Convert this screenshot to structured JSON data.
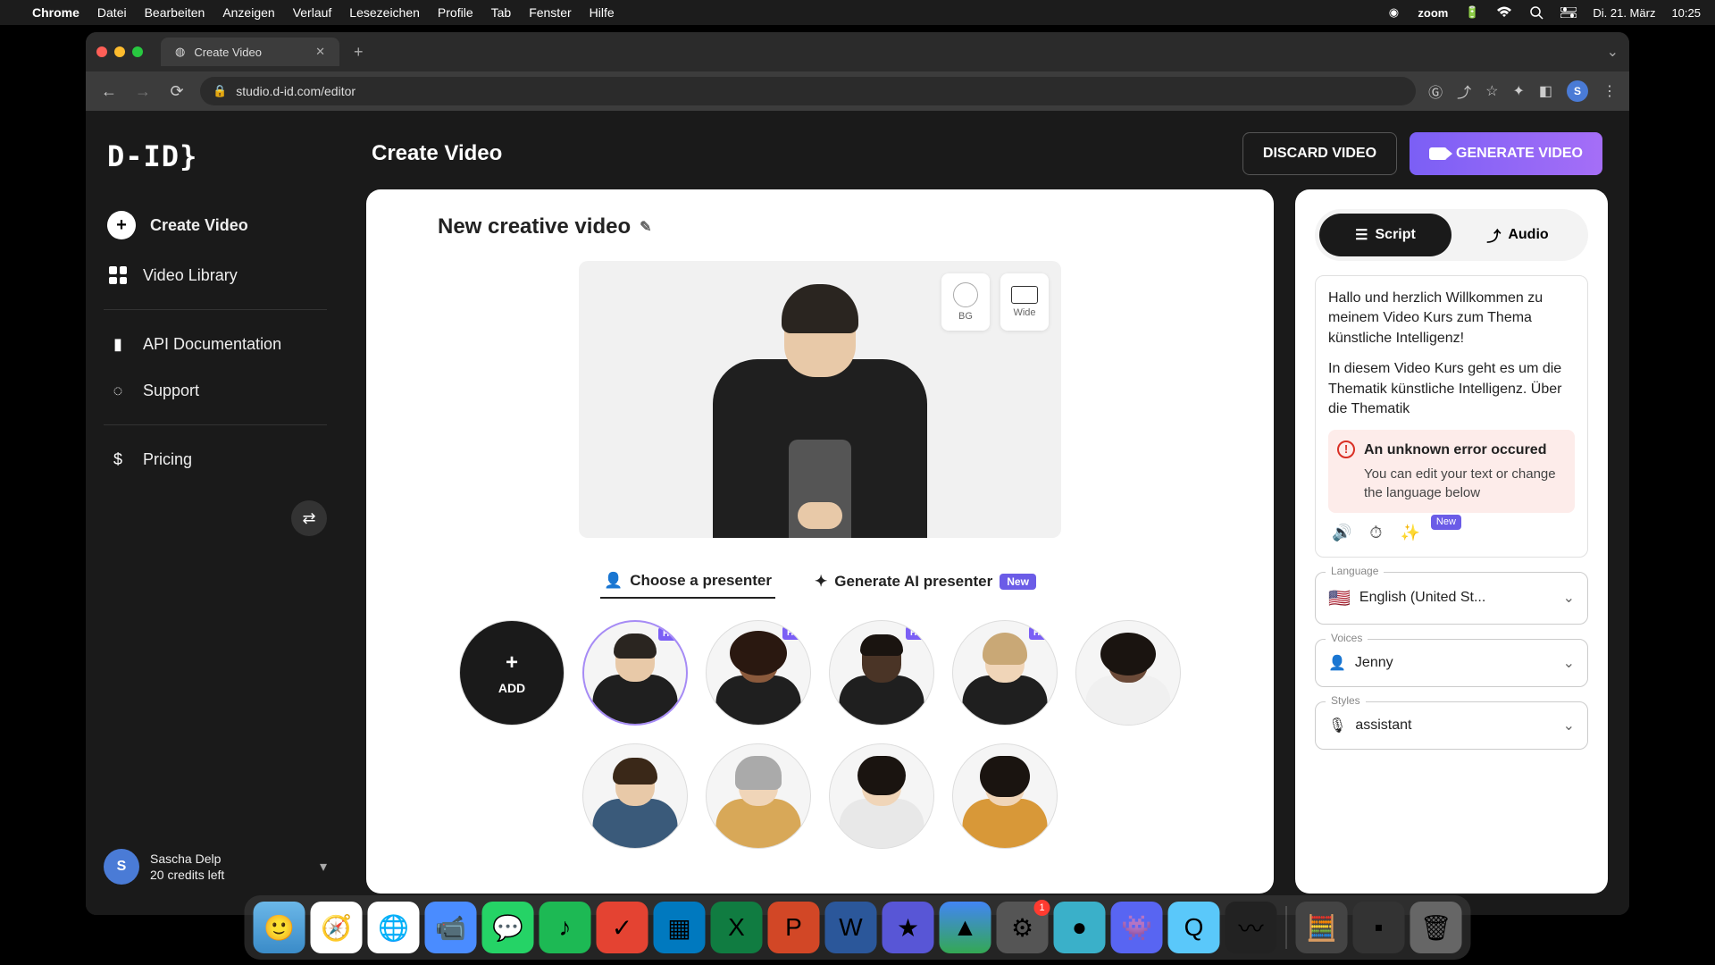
{
  "menubar": {
    "app": "Chrome",
    "items": [
      "Datei",
      "Bearbeiten",
      "Anzeigen",
      "Verlauf",
      "Lesezeichen",
      "Profile",
      "Tab",
      "Fenster",
      "Hilfe"
    ],
    "zoom": "zoom",
    "date": "Di. 21. März",
    "time": "10:25"
  },
  "browser": {
    "tab_title": "Create Video",
    "url": "studio.d-id.com/editor"
  },
  "sidebar": {
    "logo": "D-ID}",
    "create": "Create Video",
    "library": "Video Library",
    "api": "API Documentation",
    "support": "Support",
    "pricing": "Pricing",
    "user_name": "Sascha Delp",
    "user_credits": "20 credits left",
    "user_initial": "S"
  },
  "header": {
    "title": "Create Video",
    "discard": "DISCARD VIDEO",
    "generate": "GENERATE VIDEO"
  },
  "canvas": {
    "video_title": "New creative video",
    "bg_label": "BG",
    "wide_label": "Wide",
    "choose_tab": "Choose a presenter",
    "generate_tab": "Generate AI presenter",
    "new_badge": "New",
    "add_label": "ADD",
    "hq": "HQ"
  },
  "panel": {
    "script_tab": "Script",
    "audio_tab": "Audio",
    "para1": "Hallo und herzlich Willkommen zu meinem Video Kurs zum Thema künstliche Intelligenz!",
    "para2": "In diesem Video Kurs geht es um die Thematik künstliche Intelligenz. Über die Thematik",
    "error_title": "An unknown error occured",
    "error_sub": "You can edit your text or change the language below",
    "new_small": "New",
    "lang_label": "Language",
    "lang_value": "English (United St...",
    "voices_label": "Voices",
    "voices_value": "Jenny",
    "styles_label": "Styles",
    "styles_value": "assistant"
  },
  "dock": {
    "badge": "1"
  }
}
